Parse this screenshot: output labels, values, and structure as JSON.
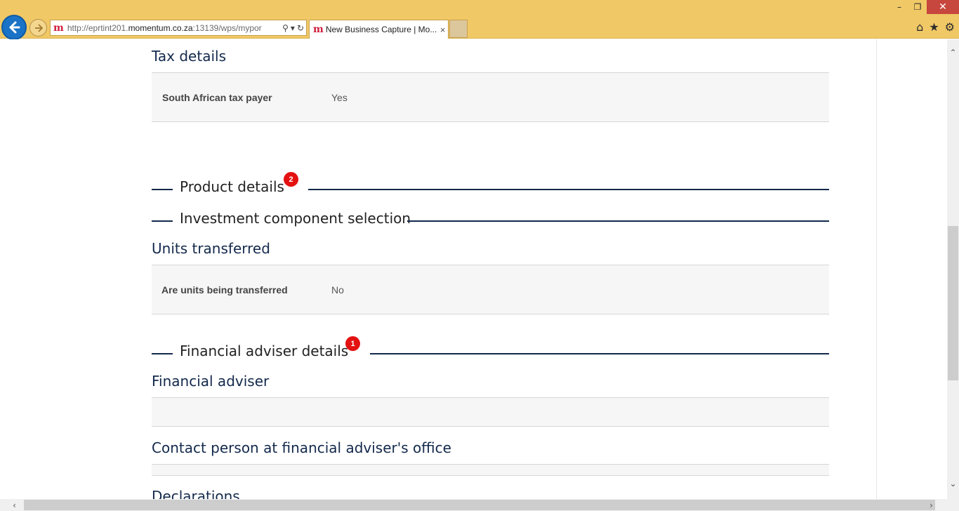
{
  "browser": {
    "url_prefix": "http://eprtint201.",
    "url_host": "momentum.co.za",
    "url_suffix": ":13139/wps/mypor",
    "logo_glyph": "m",
    "tab_title": "New Business Capture | Mo...",
    "tab_close": "×",
    "search_glyph": "⚲",
    "dropdown_glyph": "▾",
    "refresh_glyph": "↻",
    "minimize_glyph": "–",
    "restore_glyph": "❐",
    "close_glyph": "✕",
    "home_glyph": "⌂",
    "favorites_glyph": "★",
    "settings_glyph": "⚙"
  },
  "tax_details": {
    "heading": "Tax details",
    "row_label": "South African tax payer",
    "row_value": "Yes"
  },
  "product_details": {
    "title": "Product details",
    "badge": "2"
  },
  "investment": {
    "title": "Investment component selection"
  },
  "units": {
    "heading": "Units transferred",
    "row_label": "Are units being transferred",
    "row_value": "No"
  },
  "fa_details": {
    "title": "Financial adviser details",
    "badge": "1"
  },
  "financial_adviser": {
    "heading": "Financial adviser"
  },
  "contact_person": {
    "heading": "Contact person at financial adviser's office"
  },
  "declarations": {
    "heading": "Declarations"
  },
  "scroll": {
    "up": "⌃",
    "down": "⌄",
    "left": "‹",
    "right": "›"
  },
  "colors": {
    "chrome": "#f0c866",
    "navy": "#13294b",
    "badge": "#e41111",
    "panel": "#f6f6f6"
  }
}
